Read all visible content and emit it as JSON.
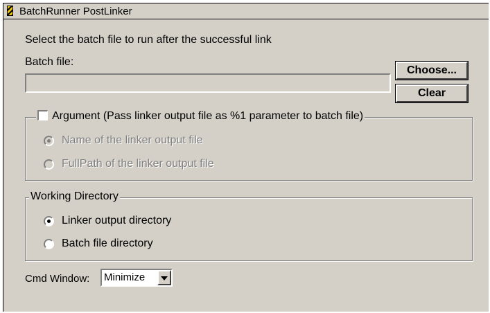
{
  "window": {
    "title": "BatchRunner PostLinker"
  },
  "instructions": "Select the batch file to run after the successful link",
  "batch_file": {
    "label": "Batch file:",
    "value": "",
    "choose_label": "Choose...",
    "clear_label": "Clear"
  },
  "argument": {
    "checkbox_label": "Argument (Pass linker output file as %1 parameter to batch file)",
    "checked": false,
    "options": [
      {
        "label": "Name of the linker output file",
        "selected": true,
        "enabled": false
      },
      {
        "label": "FullPath of the linker output file",
        "selected": false,
        "enabled": false
      }
    ]
  },
  "working_directory": {
    "legend": "Working Directory",
    "options": [
      {
        "label": "Linker output directory",
        "selected": true
      },
      {
        "label": "Batch file directory",
        "selected": false
      }
    ]
  },
  "cmd_window": {
    "label": "Cmd Window:",
    "selected": "Minimize"
  }
}
